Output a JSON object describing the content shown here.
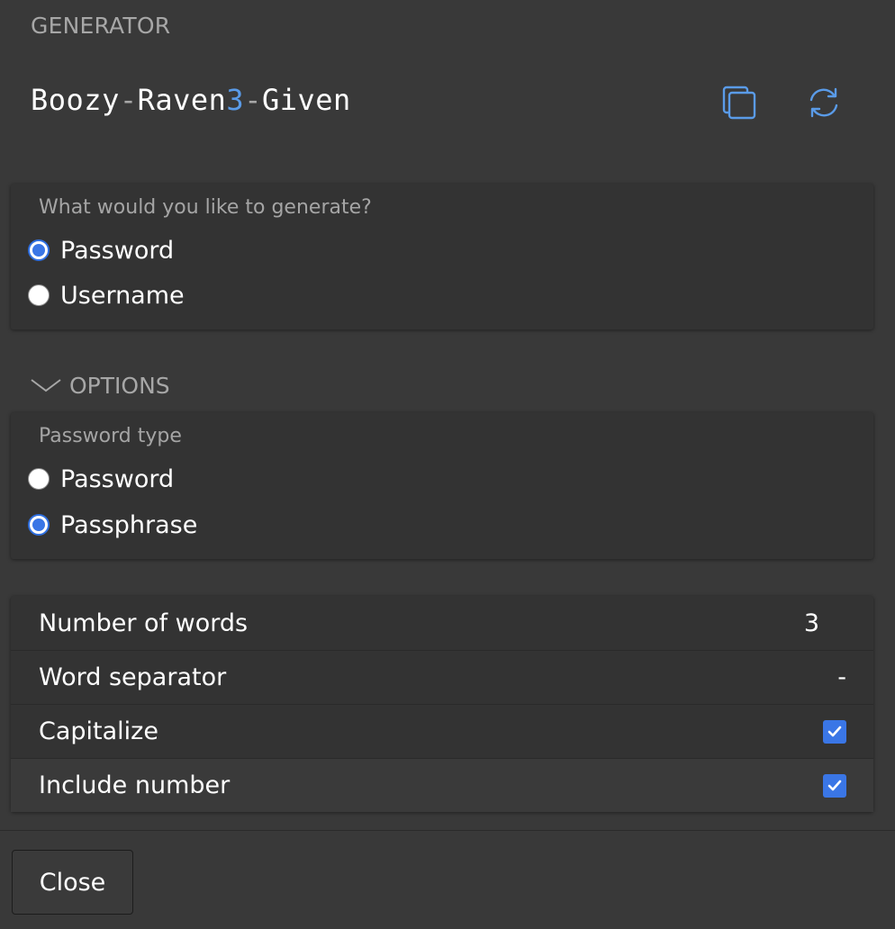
{
  "header": {
    "section_label": "GENERATOR",
    "generated_value": {
      "parts": [
        {
          "text": "Boozy",
          "kind": "word"
        },
        {
          "text": "-",
          "kind": "sep"
        },
        {
          "text": "Raven",
          "kind": "word"
        },
        {
          "text": "3",
          "kind": "num"
        },
        {
          "text": "-",
          "kind": "sep"
        },
        {
          "text": "Given",
          "kind": "word"
        }
      ]
    },
    "copy_icon": "copy-icon",
    "regenerate_icon": "refresh-icon"
  },
  "generate_type": {
    "title": "What would you like to generate?",
    "options": [
      {
        "label": "Password",
        "checked": true
      },
      {
        "label": "Username",
        "checked": false
      }
    ]
  },
  "options_section": {
    "label": "OPTIONS",
    "icon": "chevron-down-icon"
  },
  "password_type": {
    "title": "Password type",
    "options": [
      {
        "label": "Password",
        "checked": false
      },
      {
        "label": "Passphrase",
        "checked": true
      }
    ]
  },
  "settings": {
    "number_of_words": {
      "label": "Number of words",
      "value": "3"
    },
    "word_separator": {
      "label": "Word separator",
      "value": "-"
    },
    "capitalize": {
      "label": "Capitalize",
      "checked": true
    },
    "include_number": {
      "label": "Include number",
      "checked": true
    }
  },
  "footer": {
    "close_label": "Close"
  },
  "colors": {
    "accent": "#3a76e6",
    "number_highlight": "#5a9be8",
    "icon": "#5a9be8",
    "background": "#393939",
    "card": "#333333"
  }
}
